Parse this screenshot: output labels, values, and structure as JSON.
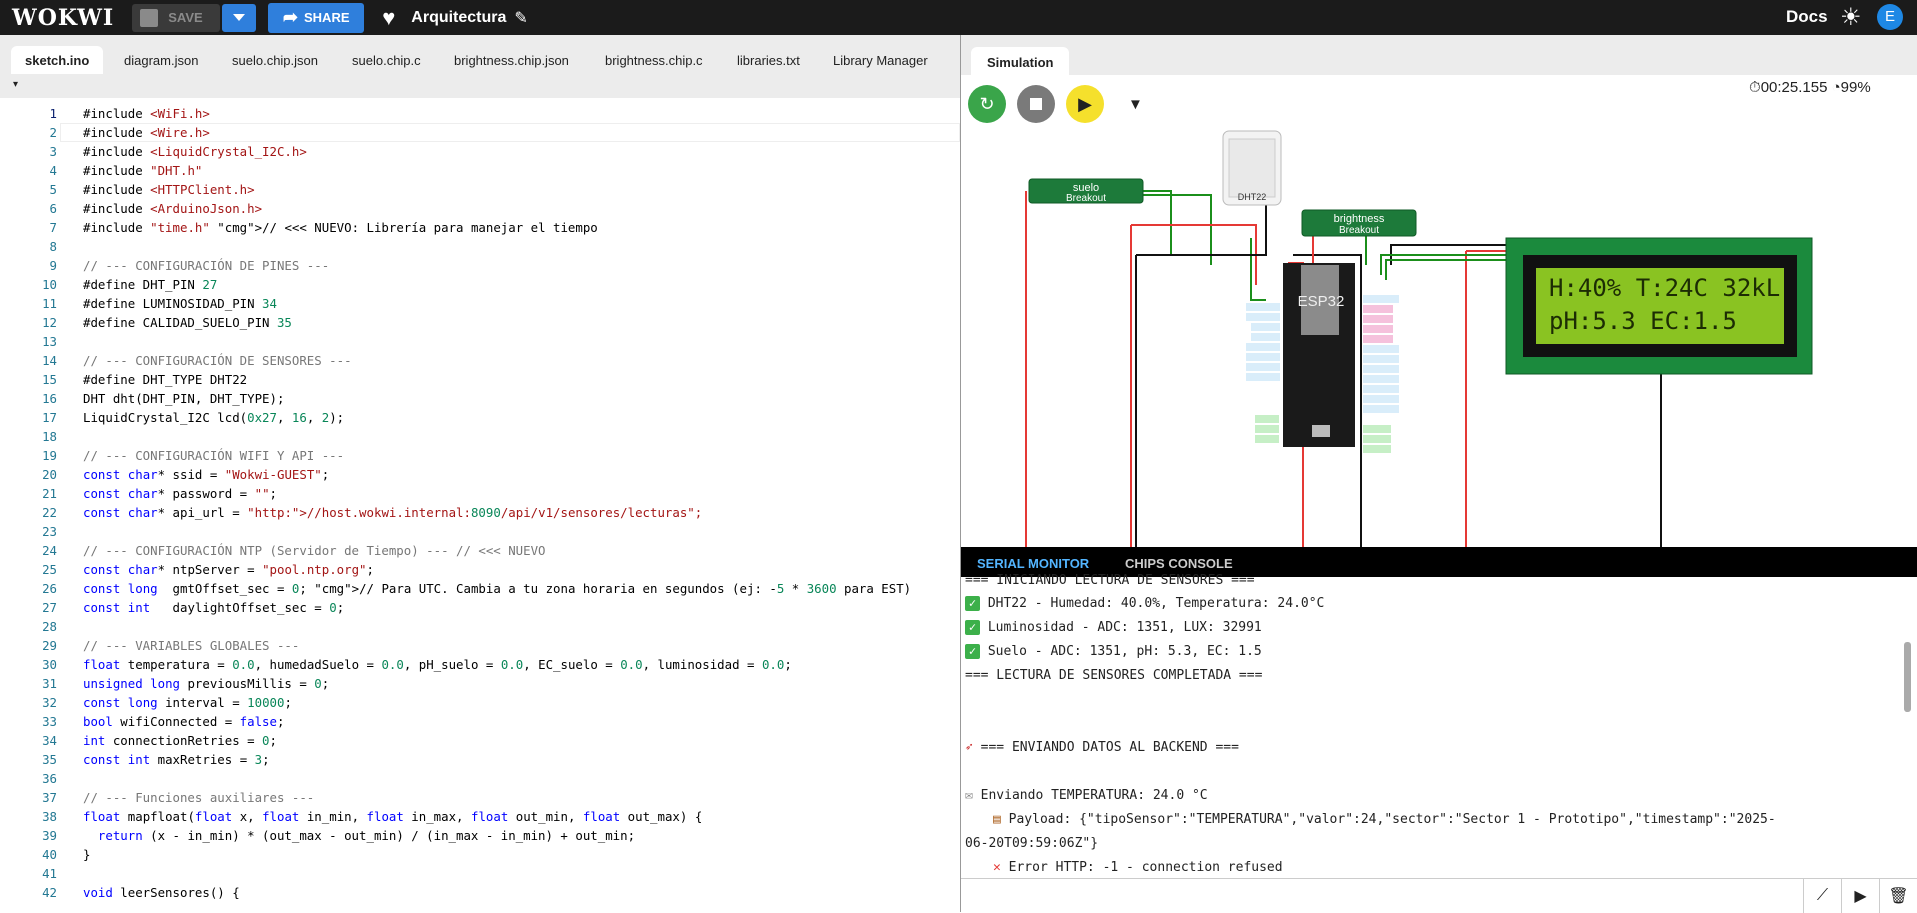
{
  "topbar": {
    "logo": "WOKWI",
    "save": "SAVE",
    "share": "SHARE",
    "project_name": "Arquitectura",
    "docs": "Docs",
    "avatar": "E"
  },
  "editor": {
    "tabs": [
      "sketch.ino",
      "diagram.json",
      "suelo.chip.json",
      "suelo.chip.c",
      "brightness.chip.json",
      "brightness.chip.c",
      "libraries.txt",
      "Library Manager"
    ],
    "active_tab": "sketch.ino",
    "more": "▾"
  },
  "code_lines": [
    "#include <WiFi.h>",
    "#include <Wire.h>",
    "#include <LiquidCrystal_I2C.h>",
    "#include \"DHT.h\"",
    "#include <HTTPClient.h>",
    "#include <ArduinoJson.h>",
    "#include \"time.h\" // <<< NUEVO: Librería para manejar el tiempo",
    "",
    "// --- CONFIGURACIÓN DE PINES ---",
    "#define DHT_PIN 27",
    "#define LUMINOSIDAD_PIN 34",
    "#define CALIDAD_SUELO_PIN 35",
    "",
    "// --- CONFIGURACIÓN DE SENSORES ---",
    "#define DHT_TYPE DHT22",
    "DHT dht(DHT_PIN, DHT_TYPE);",
    "LiquidCrystal_I2C lcd(0x27, 16, 2);",
    "",
    "// --- CONFIGURACIÓN WIFI Y API ---",
    "const char* ssid = \"Wokwi-GUEST\";",
    "const char* password = \"\";",
    "const char* api_url = \"http://host.wokwi.internal:8090/api/v1/sensores/lecturas\";",
    "",
    "// --- CONFIGURACIÓN NTP (Servidor de Tiempo) --- // <<< NUEVO",
    "const char* ntpServer = \"pool.ntp.org\";",
    "const long  gmtOffset_sec = 0; // Para UTC. Cambia a tu zona horaria en segundos (ej: -5 * 3600 para EST)",
    "const int   daylightOffset_sec = 0;",
    "",
    "// --- VARIABLES GLOBALES ---",
    "float temperatura = 0.0, humedadSuelo = 0.0, pH_suelo = 0.0, EC_suelo = 0.0, luminosidad = 0.0;",
    "unsigned long previousMillis = 0;",
    "const long interval = 10000;",
    "bool wifiConnected = false;",
    "int connectionRetries = 0;",
    "const int maxRetries = 3;",
    "",
    "// --- Funciones auxiliares ---",
    "float mapfloat(float x, float in_min, float in_max, float out_min, float out_max) {",
    "  return (x - in_min) * (out_max - out_min) / (in_max - in_min) + out_min;",
    "}",
    "",
    "void leerSensores() {"
  ],
  "simulation": {
    "tab": "Simulation",
    "timer": "00:25.155",
    "speed": "99%",
    "lcd_line1": "H:40% T:24C 32kL",
    "lcd_line2": "pH:5.3 EC:1.5",
    "suelo_label": "suelo",
    "suelo_sub": "Breakout",
    "brightness_label": "brightness",
    "brightness_sub": "Breakout",
    "dht_label": "DHT22",
    "esp_label": "ESP32"
  },
  "serial": {
    "tabs": [
      "SERIAL MONITOR",
      "CHIPS CONSOLE"
    ],
    "lines": [
      "=== INICIANDO LECTURA DE SENSORES ===",
      "DHT22 - Humedad: 40.0%, Temperatura: 24.0°C",
      "Luminosidad - ADC: 1351, LUX: 32991",
      "Suelo - ADC: 1351, pH: 5.3, EC: 1.5",
      "=== LECTURA DE SENSORES COMPLETADA ===",
      "",
      "",
      "=== ENVIANDO DATOS AL BACKEND ===",
      "",
      "Enviando TEMPERATURA: 24.0 °C",
      "Payload: {\"tipoSensor\":\"TEMPERATURA\",\"valor\":24,\"sector\":\"Sector 1 - Prototipo\",\"timestamp\":\"2025-",
      "06-20T09:59:06Z\"}",
      "Error HTTP: -1 - connection refused"
    ]
  }
}
